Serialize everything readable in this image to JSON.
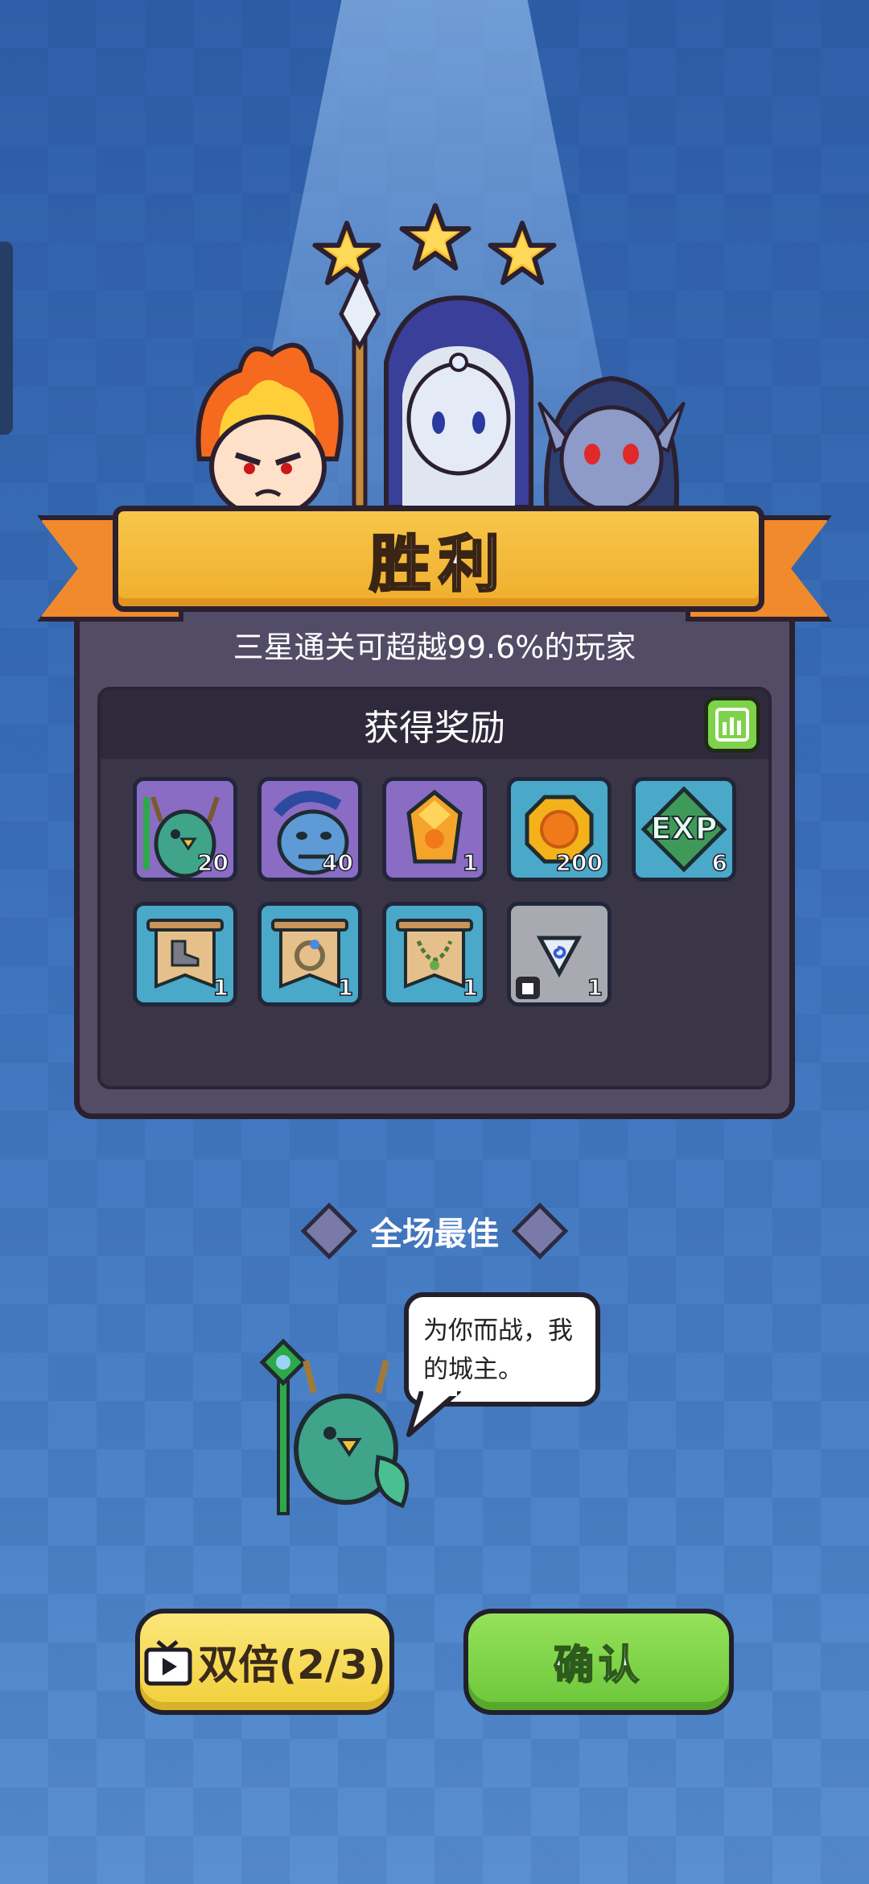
{
  "result": {
    "title": "胜利",
    "stars": 3,
    "subtitle": "三星通关可超越99.6%的玩家"
  },
  "rewards": {
    "header": "获得奖励",
    "stats_icon": "bar-chart-icon",
    "items": [
      {
        "name": "owl-hero-shard-icon",
        "qty": "20",
        "color": "#8a6cc4"
      },
      {
        "name": "troll-hero-shard-icon",
        "qty": "40",
        "color": "#8a6cc4"
      },
      {
        "name": "orange-crystal-icon",
        "qty": "1",
        "color": "#8a6cc4"
      },
      {
        "name": "gold-coin-icon",
        "qty": "200",
        "color": "#4aa8c8"
      },
      {
        "name": "exp-icon",
        "qty": "6",
        "color": "#4aa8c8"
      },
      {
        "name": "boots-scroll-icon",
        "qty": "1",
        "color": "#4aa8c8"
      },
      {
        "name": "ring-scroll-icon",
        "qty": "1",
        "color": "#4aa8c8"
      },
      {
        "name": "necklace-scroll-icon",
        "qty": "1",
        "color": "#4aa8c8"
      },
      {
        "name": "gem-armor-icon",
        "qty": "1",
        "color": "#a9a9b2"
      }
    ]
  },
  "mvp": {
    "label": "全场最佳",
    "quote": "为你而战，我的城主。"
  },
  "buttons": {
    "double_label": "双倍(2/3)",
    "double_icon": "tv-ad-icon",
    "confirm_label": "确认"
  }
}
